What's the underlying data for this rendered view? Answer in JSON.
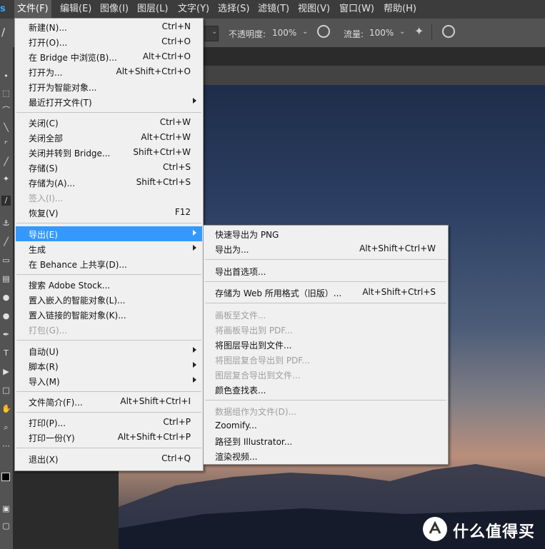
{
  "menubar": {
    "logo": "s",
    "items": [
      "文件(F)",
      "编辑(E)",
      "图像(I)",
      "图层(L)",
      "文字(Y)",
      "选择(S)",
      "滤镜(T)",
      "视图(V)",
      "窗口(W)",
      "帮助(H)"
    ],
    "active_item": "文件(F)"
  },
  "options_bar": {
    "opacity_label": "不透明度:",
    "opacity_value": "100%",
    "flow_label": "流量:",
    "flow_value": "100%"
  },
  "file_menu": [
    {
      "label": "新建(N)...",
      "shortcut": "Ctrl+N"
    },
    {
      "label": "打开(O)...",
      "shortcut": "Ctrl+O"
    },
    {
      "label": "在 Bridge 中浏览(B)...",
      "shortcut": "Alt+Ctrl+O"
    },
    {
      "label": "打开为...",
      "shortcut": "Alt+Shift+Ctrl+O"
    },
    {
      "label": "打开为智能对象..."
    },
    {
      "label": "最近打开文件(T)",
      "submenu": true
    },
    {
      "sep": true
    },
    {
      "label": "关闭(C)",
      "shortcut": "Ctrl+W"
    },
    {
      "label": "关闭全部",
      "shortcut": "Alt+Ctrl+W"
    },
    {
      "label": "关闭并转到 Bridge...",
      "shortcut": "Shift+Ctrl+W"
    },
    {
      "label": "存储(S)",
      "shortcut": "Ctrl+S"
    },
    {
      "label": "存储为(A)...",
      "shortcut": "Shift+Ctrl+S"
    },
    {
      "label": "签入(I)...",
      "disabled": true
    },
    {
      "label": "恢复(V)",
      "shortcut": "F12"
    },
    {
      "sep": true
    },
    {
      "label": "导出(E)",
      "submenu": true,
      "highlighted": true
    },
    {
      "label": "生成",
      "submenu": true
    },
    {
      "label": "在 Behance 上共享(D)..."
    },
    {
      "sep": true
    },
    {
      "label": "搜索 Adobe Stock..."
    },
    {
      "label": "置入嵌入的智能对象(L)..."
    },
    {
      "label": "置入链接的智能对象(K)..."
    },
    {
      "label": "打包(G)...",
      "disabled": true
    },
    {
      "sep": true
    },
    {
      "label": "自动(U)",
      "submenu": true
    },
    {
      "label": "脚本(R)",
      "submenu": true
    },
    {
      "label": "导入(M)",
      "submenu": true
    },
    {
      "sep": true
    },
    {
      "label": "文件简介(F)...",
      "shortcut": "Alt+Shift+Ctrl+I"
    },
    {
      "sep": true
    },
    {
      "label": "打印(P)...",
      "shortcut": "Ctrl+P"
    },
    {
      "label": "打印一份(Y)",
      "shortcut": "Alt+Shift+Ctrl+P"
    },
    {
      "sep": true
    },
    {
      "label": "退出(X)",
      "shortcut": "Ctrl+Q"
    }
  ],
  "export_submenu": [
    {
      "label": "快速导出为 PNG"
    },
    {
      "label": "导出为...",
      "shortcut": "Alt+Shift+Ctrl+W"
    },
    {
      "sep": true
    },
    {
      "label": "导出首选项..."
    },
    {
      "sep": true
    },
    {
      "label": "存储为 Web 所用格式（旧版）...",
      "shortcut": "Alt+Shift+Ctrl+S",
      "marked": true
    },
    {
      "sep": true
    },
    {
      "label": "画板至文件...",
      "disabled": true
    },
    {
      "label": "将画板导出到 PDF...",
      "disabled": true
    },
    {
      "label": "将图层导出到文件..."
    },
    {
      "label": "将图层复合导出到 PDF...",
      "disabled": true
    },
    {
      "label": "图层复合导出到文件...",
      "disabled": true
    },
    {
      "label": "颜色查找表..."
    },
    {
      "sep": true
    },
    {
      "label": "数据组作为文件(D)...",
      "disabled": true
    },
    {
      "label": "Zoomify..."
    },
    {
      "label": "路径到 Illustrator..."
    },
    {
      "label": "渲染视频..."
    }
  ],
  "watermark": {
    "text": "什么值得买",
    "logo_glyph": "值"
  },
  "colors": {
    "menu_highlight": "#3399ff",
    "marker": "#ffff00",
    "menubar": "#3c3c3c"
  }
}
